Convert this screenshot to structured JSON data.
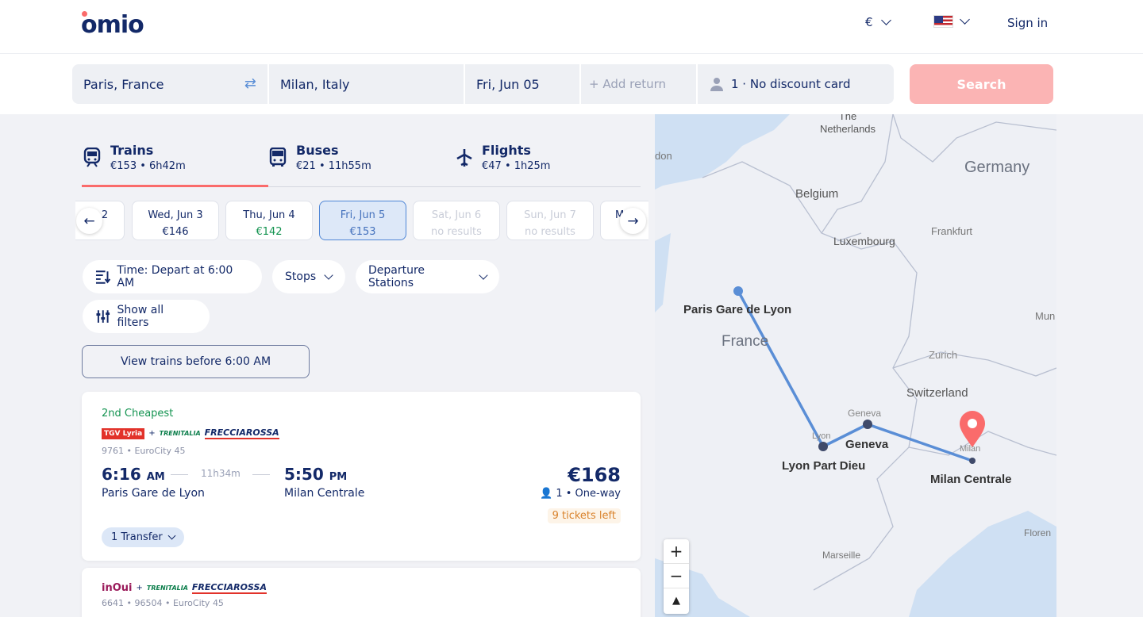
{
  "header": {
    "logo": "omio",
    "currency": "€",
    "signin": "Sign in"
  },
  "search": {
    "from": "Paris, France",
    "to": "Milan, Italy",
    "date": "Fri, Jun 05",
    "return_placeholder": "+ Add return",
    "passengers": "1 · No discount card",
    "button": "Search"
  },
  "tabs": [
    {
      "label": "Trains",
      "sub": "€153 • 6h42m",
      "icon": "train-icon"
    },
    {
      "label": "Buses",
      "sub": "€21 • 11h55m",
      "icon": "bus-icon"
    },
    {
      "label": "Flights",
      "sub": "€47 • 1h25m",
      "icon": "plane-icon"
    }
  ],
  "dates": [
    {
      "day": "2",
      "price": ""
    },
    {
      "day": "Wed, Jun 3",
      "price": "€146"
    },
    {
      "day": "Thu, Jun 4",
      "price": "€142"
    },
    {
      "day": "Fri, Jun 5",
      "price": "€153"
    },
    {
      "day": "Sat, Jun 6",
      "price": "no results"
    },
    {
      "day": "Sun, Jun 7",
      "price": "no results"
    },
    {
      "day": "M",
      "price": ""
    }
  ],
  "filters": {
    "time": "Time: Depart at 6:00 AM",
    "stops": "Stops",
    "departure": "Departure Stations",
    "all": "Show all filters"
  },
  "view_before": "View trains before 6:00 AM",
  "results": [
    {
      "badge": "2nd Cheapest",
      "carrier1": "TGV Lyria",
      "carrier2": "TRENITALIA",
      "carrier3": "FRECCIAROSSA",
      "train_no": "9761 • EuroCity 45",
      "dep_time": "6:16",
      "dep_ampm": "AM",
      "duration": "11h34m",
      "arr_time": "5:50",
      "arr_ampm": "PM",
      "dep_station": "Paris Gare de Lyon",
      "arr_station": "Milan Centrale",
      "price": "€168",
      "pax": "1",
      "trip": "One-way",
      "tickets": "9 tickets left",
      "transfer": "1 Transfer"
    },
    {
      "carrier1": "inOui",
      "carrier2": "TRENITALIA",
      "carrier3": "FRECCIAROSSA",
      "train_no": "6641 • 96504 • EuroCity 45"
    }
  ],
  "map": {
    "labels": {
      "netherlands": "The Netherlands",
      "germany": "Germany",
      "belgium": "Belgium",
      "luxembourg": "Luxembourg",
      "frankfurt": "Frankfurt",
      "london": "don",
      "paris": "Paris Gare de Lyon",
      "france": "France",
      "zurich": "Zurich",
      "switzerland": "Switzerland",
      "geneva_small": "Geneva",
      "geneva": "Geneva",
      "lyon_small": "Lyon",
      "lyon": "Lyon Part Dieu",
      "milan_small": "Milan",
      "milan": "Milan Centrale",
      "munich": "Mun",
      "florence": "Floren",
      "marseille": "Marseille"
    },
    "zoom_in": "+",
    "zoom_out": "−",
    "compass": "▲"
  },
  "colors": {
    "brand": "#fa6b6b",
    "navy": "#132968",
    "route": "#5a8ed6",
    "green": "#139350"
  }
}
